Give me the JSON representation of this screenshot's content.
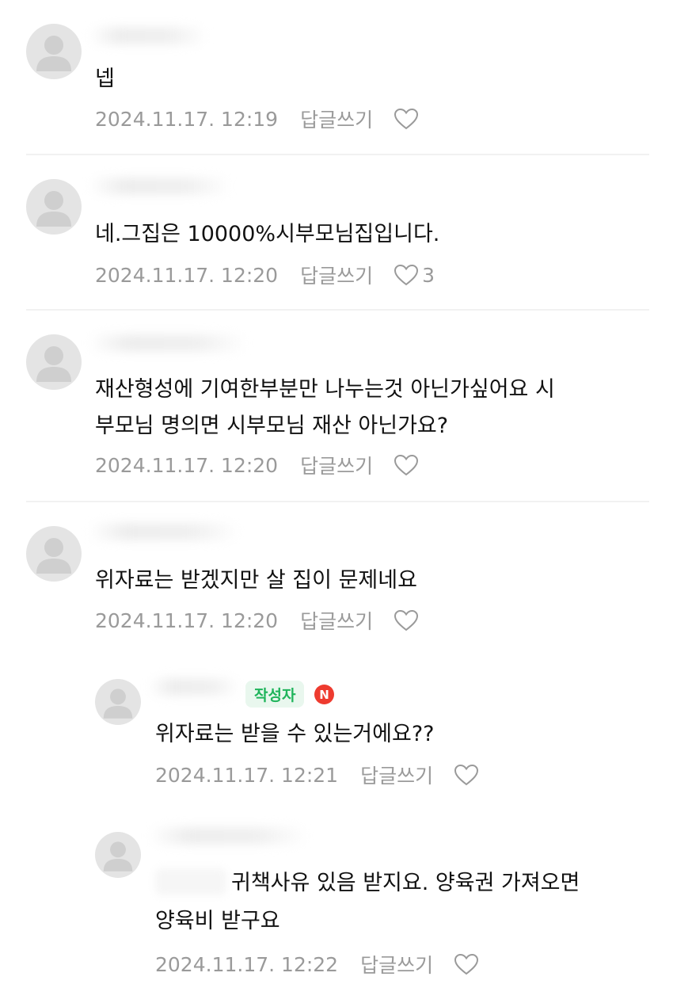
{
  "reply_label": "답글쓰기",
  "colors": {
    "meta_text": "#9a9a9a",
    "author_badge_bg": "#e9f7ee",
    "author_badge_text": "#1fb45b",
    "new_badge": "#ee3b2f"
  },
  "icons": {
    "avatar": "default-user-avatar",
    "like": "heart-outline-icon"
  },
  "comments": [
    {
      "text": "넵",
      "date": "2024.11.17. 12:19",
      "likes": ""
    },
    {
      "text": "네.그집은 10000%시부모님집입니다.",
      "date": "2024.11.17. 12:20",
      "likes": "3"
    },
    {
      "text_line1": "재산형성에 기여한부분만 나누는것 아닌가싶어요 시",
      "text_line2": "부모님 명의면 시부모님 재산 아닌가요?",
      "date": "2024.11.17. 12:20",
      "likes": ""
    },
    {
      "text": "위자료는 받겠지만 살 집이 문제네요",
      "date": "2024.11.17. 12:20",
      "likes": ""
    }
  ],
  "replies": [
    {
      "author_badge": "작성자",
      "new_badge": "N",
      "text": "위자료는 받을 수 있는거에요??",
      "date": "2024.11.17. 12:21",
      "likes": ""
    },
    {
      "text_line1": "귀책사유 있음 받지요. 양육권 가져오면",
      "text_line2": "양육비 받구요",
      "date": "2024.11.17. 12:22",
      "likes": ""
    }
  ]
}
